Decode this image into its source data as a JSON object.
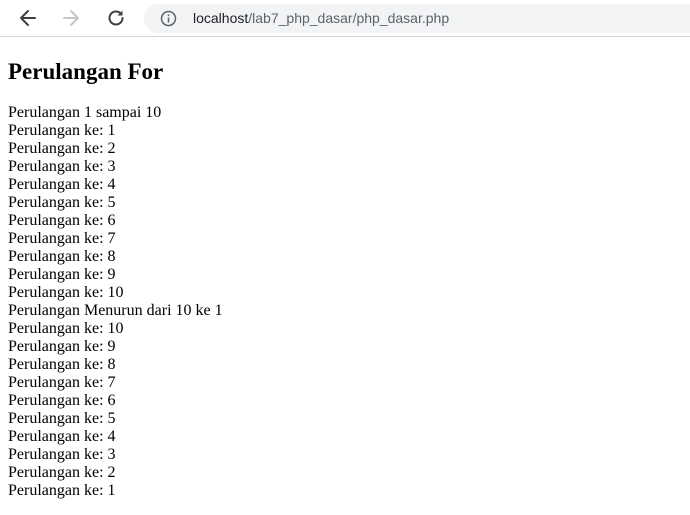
{
  "browser": {
    "url_host": "localhost",
    "url_path": "/lab7_php_dasar/php_dasar.php",
    "icons": [
      "back-arrow-icon",
      "forward-arrow-icon",
      "reload-icon",
      "info-icon"
    ]
  },
  "page": {
    "heading": "Perulangan For",
    "lines": [
      "Perulangan 1 sampai 10",
      "Perulangan ke: 1",
      "Perulangan ke: 2",
      "Perulangan ke: 3",
      "Perulangan ke: 4",
      "Perulangan ke: 5",
      "Perulangan ke: 6",
      "Perulangan ke: 7",
      "Perulangan ke: 8",
      "Perulangan ke: 9",
      "Perulangan ke: 10",
      "Perulangan Menurun dari 10 ke 1",
      "Perulangan ke: 10",
      "Perulangan ke: 9",
      "Perulangan ke: 8",
      "Perulangan ke: 7",
      "Perulangan ke: 6",
      "Perulangan ke: 5",
      "Perulangan ke: 4",
      "Perulangan ke: 3",
      "Perulangan ke: 2",
      "Perulangan ke: 1"
    ]
  }
}
